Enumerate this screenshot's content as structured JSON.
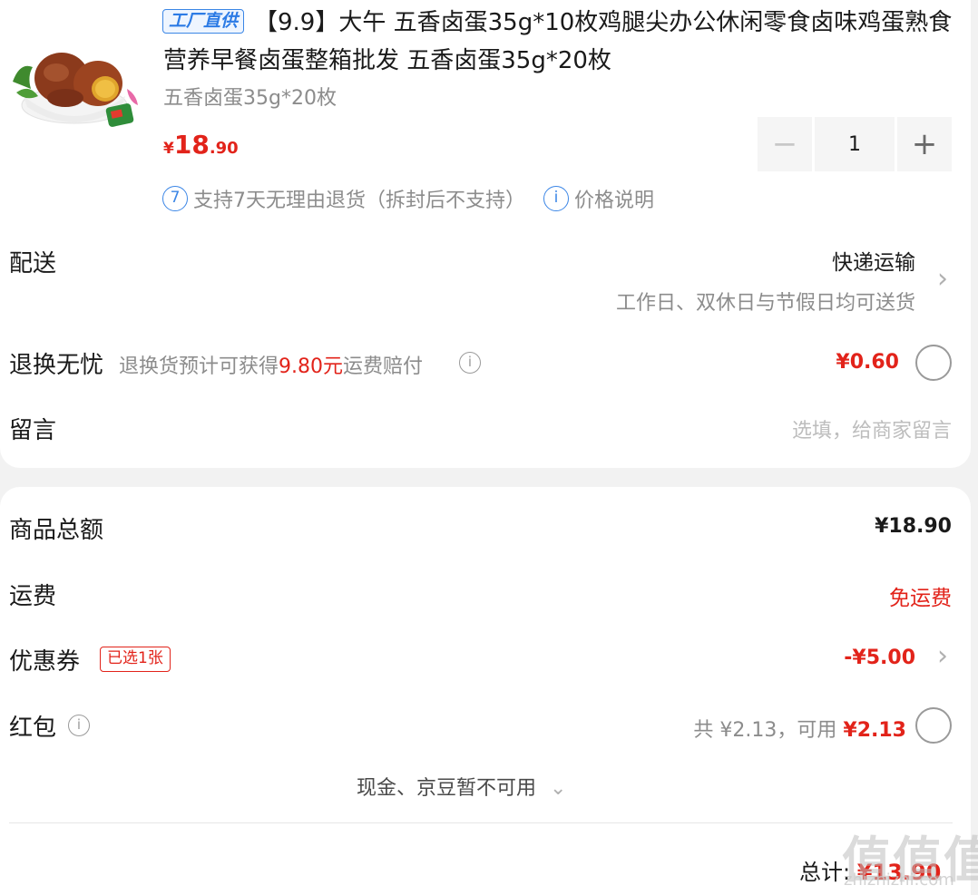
{
  "product": {
    "tag": "工厂直供",
    "title": "【9.9】大午 五香卤蛋35g*10枚鸡腿尖办公休闲零食卤味鸡蛋熟食营养早餐卤蛋整箱批发 五香卤蛋35g*20枚",
    "spec": "五香卤蛋35g*20枚",
    "price_currency": "¥",
    "price_int": "18",
    "price_dec": ".90",
    "quantity": "1",
    "minus_label": "−",
    "plus_label": "+",
    "return_icon": "7",
    "return_policy": "支持7天无理由退货（拆封后不支持）",
    "price_info_icon": "i",
    "price_info": "价格说明"
  },
  "delivery": {
    "label": "配送",
    "method": "快递运输",
    "detail": "工作日、双休日与节假日均可送货"
  },
  "return_worry": {
    "label": "退换无忧",
    "desc_prefix": "退换货预计可获得",
    "desc_amount": "9.80元",
    "desc_suffix": "运费赔付",
    "price": "¥0.60"
  },
  "message": {
    "label": "留言",
    "placeholder": "选填，给商家留言"
  },
  "summary": {
    "goods_total_label": "商品总额",
    "goods_total_value": "¥18.90",
    "shipping_label": "运费",
    "shipping_value": "免运费",
    "coupon_label": "优惠券",
    "coupon_badge": "已选1张",
    "coupon_value": "-¥5.00",
    "redpacket_label": "红包",
    "redpacket_total": "共 ¥2.13，可用",
    "redpacket_available": "¥2.13",
    "cash_note": "现金、京豆暂不可用",
    "total_label": "总计:",
    "total_value": "¥13.90"
  },
  "watermark": {
    "text": "值值值",
    "sub": "zhizhizhi.com"
  },
  "colors": {
    "accent_red": "#e2231a",
    "accent_blue": "#2c7be5",
    "muted": "#8c8c8c"
  }
}
